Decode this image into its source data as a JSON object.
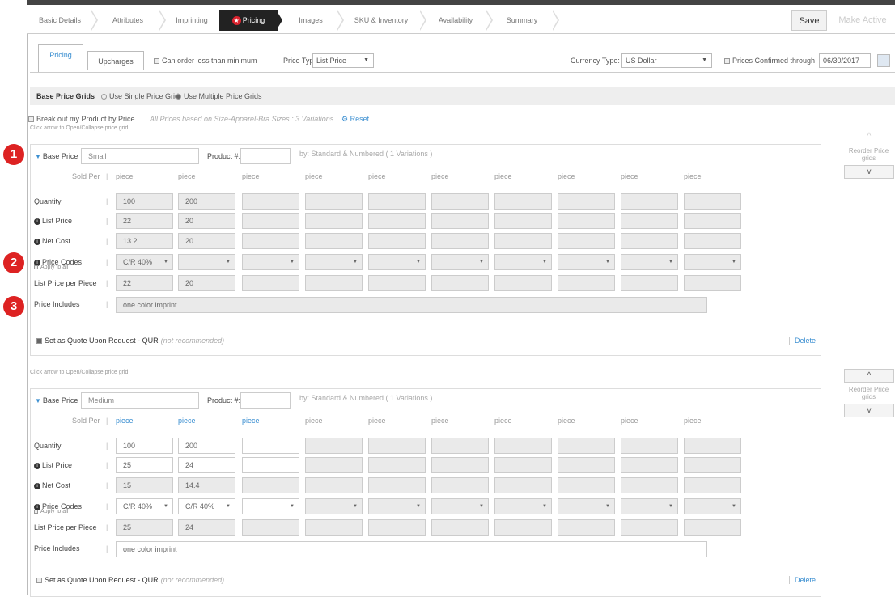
{
  "nav": {
    "steps": [
      {
        "label": "Basic Details"
      },
      {
        "label": "Attributes"
      },
      {
        "label": "Imprinting"
      },
      {
        "label": "Pricing",
        "star": "★"
      },
      {
        "label": "Images"
      },
      {
        "label": "SKU & Inventory"
      },
      {
        "label": "Availability"
      },
      {
        "label": "Summary"
      }
    ],
    "save": "Save",
    "make_active": "Make Active"
  },
  "tabs": {
    "pricing": "Pricing",
    "upcharges": "Upcharges"
  },
  "options": {
    "can_order_less": "Can order less than minimum",
    "price_type_label": "Price Type",
    "price_type": "List Price",
    "currency_label": "Currency Type:",
    "currency": "US Dollar",
    "confirmed_label": "Prices Confirmed through",
    "confirmed_date": "06/30/2017"
  },
  "grids_bar": {
    "title": "Base Price Grids",
    "single": "Use Single Price Grid",
    "multiple": "Use Multiple Price Grids"
  },
  "breakout": {
    "label": "Break out my Product by Price",
    "note": "All Prices based on Size-Apparel-Bra Sizes : 3 Variations",
    "reset": "Reset"
  },
  "reorder": {
    "label": "Reorder Price grids",
    "up": "^",
    "down": "v"
  },
  "labels": {
    "click_arrow": "Click arrow to Open/Collapse price grid.",
    "base_price": "Base Price",
    "product_num": "Product #:",
    "sold_per": "Sold Per",
    "quantity": "Quantity",
    "list_price": "List Price",
    "net_cost": "Net Cost",
    "price_codes": "Price Codes",
    "apply_all": "Apply to all",
    "list_per_piece": "List Price per Piece",
    "price_includes": "Price Includes",
    "qur": "Set as Quote Upon Request - QUR",
    "qur_note": "(not recommended)",
    "delete": "Delete",
    "piece": "piece"
  },
  "grids": [
    {
      "name": "Small",
      "variations": "by: Standard & Numbered ( 1 Variations )",
      "quantity": [
        "100",
        "200",
        "",
        "",
        "",
        "",
        "",
        "",
        "",
        ""
      ],
      "list": [
        "22",
        "20",
        "",
        "",
        "",
        "",
        "",
        "",
        "",
        ""
      ],
      "net": [
        "13.2",
        "20",
        "",
        "",
        "",
        "",
        "",
        "",
        "",
        ""
      ],
      "codes": [
        "C/R 40%",
        "",
        "",
        "",
        "",
        "",
        "",
        "",
        "",
        ""
      ],
      "per_piece": [
        "22",
        "20",
        "",
        "",
        "",
        "",
        "",
        "",
        "",
        ""
      ],
      "includes": "one color imprint"
    },
    {
      "name": "Medium",
      "variations": "by: Standard & Numbered ( 1 Variations )",
      "quantity": [
        "100",
        "200",
        "",
        "",
        "",
        "",
        "",
        "",
        "",
        ""
      ],
      "list": [
        "25",
        "24",
        "",
        "",
        "",
        "",
        "",
        "",
        "",
        ""
      ],
      "net": [
        "15",
        "14.4",
        "",
        "",
        "",
        "",
        "",
        "",
        "",
        ""
      ],
      "codes": [
        "C/R 40%",
        "C/R 40%",
        "",
        "",
        "",
        "",
        "",
        "",
        "",
        ""
      ],
      "per_piece": [
        "25",
        "24",
        "",
        "",
        "",
        "",
        "",
        "",
        "",
        ""
      ],
      "includes": "one color imprint"
    }
  ],
  "badges": [
    "1",
    "2",
    "3"
  ]
}
